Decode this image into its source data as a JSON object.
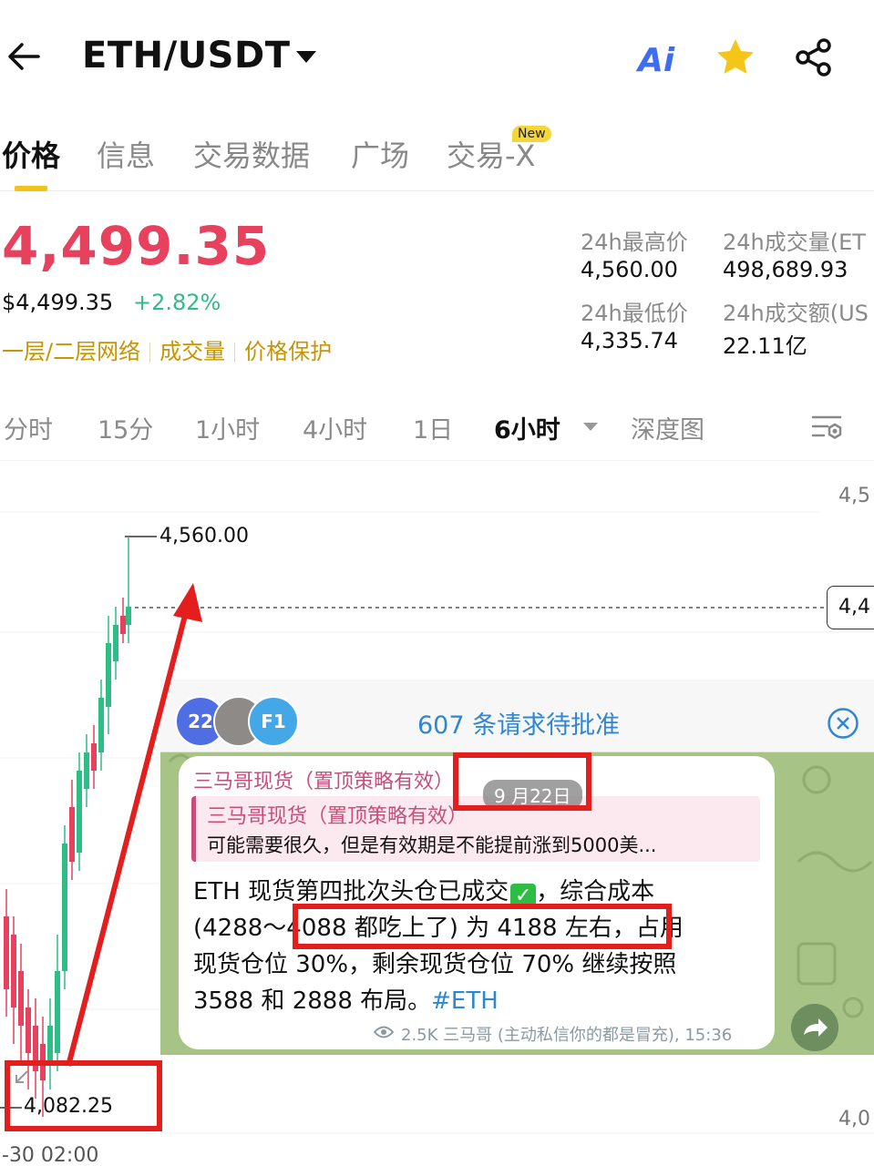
{
  "header": {
    "pair": "ETH/USDT",
    "ai_label": "Ai",
    "icons": [
      "back-arrow-icon",
      "dropdown-caret-icon",
      "ai-icon",
      "star-icon",
      "share-icon"
    ]
  },
  "tabs": [
    {
      "label": "价格"
    },
    {
      "label": "信息"
    },
    {
      "label": "交易数据"
    },
    {
      "label": "广场"
    },
    {
      "label": "交易-X"
    }
  ],
  "new_badge": "New",
  "price": {
    "last": "4,499.35",
    "usd": "$4,499.35",
    "change": "+2.82%",
    "tags": [
      "一层/二层网络",
      "成交量",
      "价格保护"
    ]
  },
  "stats": {
    "high_label": "24h最高价",
    "high_value": "4,560.00",
    "vol_label": "24h成交量(ET",
    "vol_value": "498,689.93",
    "low_label": "24h最低价",
    "low_value": "4,335.74",
    "turnover_label": "24h成交额(US",
    "turnover_value": "22.11亿"
  },
  "intervals": [
    {
      "label": "分时"
    },
    {
      "label": "15分"
    },
    {
      "label": "1小时"
    },
    {
      "label": "4小时"
    },
    {
      "label": "1日"
    },
    {
      "label": "6小时"
    },
    {
      "label": "深度图"
    }
  ],
  "chart": {
    "high_label": "4,560.00",
    "low_label": "4,082.25",
    "axis_top": "4,5",
    "axis_bottom": "4,0",
    "current_tag": "4,4",
    "time_label": "-30 02:00",
    "colors": {
      "up": "#2ebd85",
      "down": "#e8415e"
    }
  },
  "message": {
    "avatars": [
      "22",
      "F1"
    ],
    "request_text": "607 条请求待批准",
    "sender": "三马哥现货（置顶策略有效）",
    "date": "9 月22日",
    "quote_title": "三马哥现货（置顶策略有效）",
    "quote_text": "可能需要很久，但是有效期是不能提前涨到5000美...",
    "line1": "ETH 现货第四批次头仓已成交",
    "line1_tail": "，综合成本",
    "line2": "(4288～4088 都吃上了) 为 4188 左右，占用",
    "line3": "现货仓位 30%，剩余现货仓位 70% 继续按照",
    "line4": "3588 和 2888 布局。",
    "hashtag": "#ETH",
    "meta": "2.5K 三马哥 (主动私信你的都是冒充), 15:36",
    "check_mark": "✓"
  }
}
